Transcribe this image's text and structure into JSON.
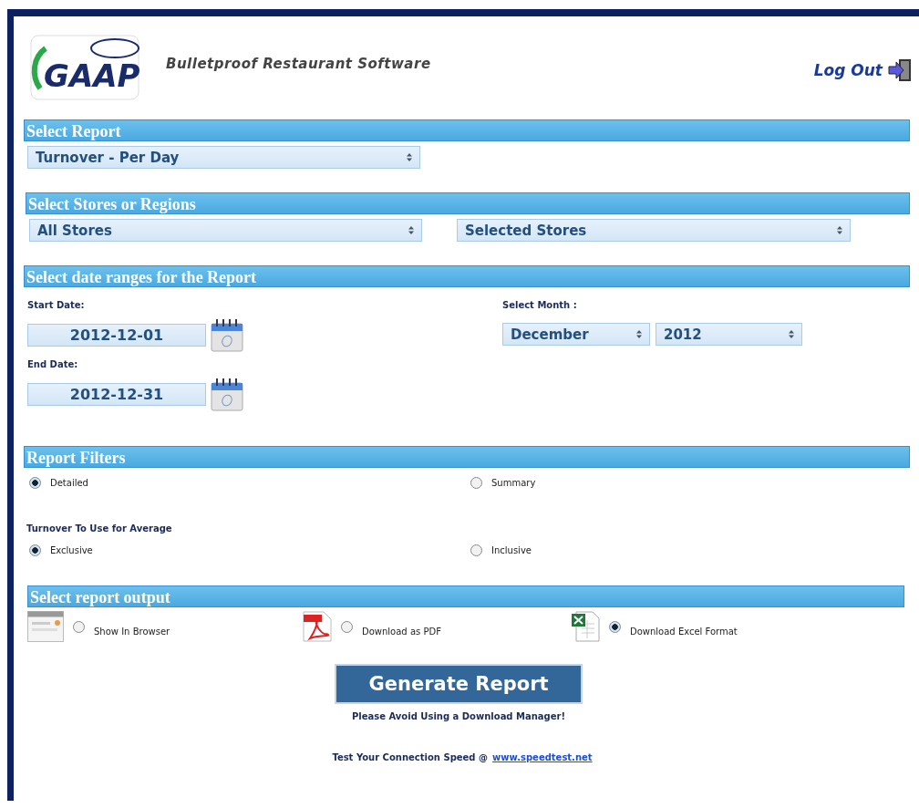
{
  "header": {
    "logo_text": "GAAP",
    "tagline": "Bulletproof Restaurant Software",
    "logout": "Log Out"
  },
  "report": {
    "title": "Select Report",
    "value": "Turnover - Per Day"
  },
  "stores": {
    "title": "Select Stores or Regions",
    "values": [
      "All Stores",
      "Selected Stores"
    ]
  },
  "dates": {
    "title": "Select date ranges for the Report",
    "start_label": "Start Date:",
    "start": "2012-12-01",
    "end_label": "End Date:",
    "end": "2012-12-31",
    "month_label": "Select Month :",
    "month": "December",
    "year": "2012"
  },
  "filters": {
    "title": "Report Filters",
    "detail": [
      {
        "label": "Detailed",
        "selected": true
      },
      {
        "label": "Summary",
        "selected": false
      }
    ],
    "average_label": "Turnover To Use for Average",
    "average": [
      {
        "label": "Exclusive",
        "selected": true
      },
      {
        "label": "Inclusive",
        "selected": false
      }
    ]
  },
  "output": {
    "title": "Select report output",
    "options": [
      {
        "kind": "browser",
        "label": "Show In Browser",
        "selected": false
      },
      {
        "kind": "pdf",
        "label": "Download as PDF",
        "selected": false
      },
      {
        "kind": "excel",
        "label": "Download Excel Format",
        "selected": true
      }
    ]
  },
  "generate": "Generate Report",
  "note": "Please Avoid Using a Download Manager!",
  "speed": {
    "text": "Test Your Connection Speed @",
    "link": "www.speedtest.net"
  }
}
